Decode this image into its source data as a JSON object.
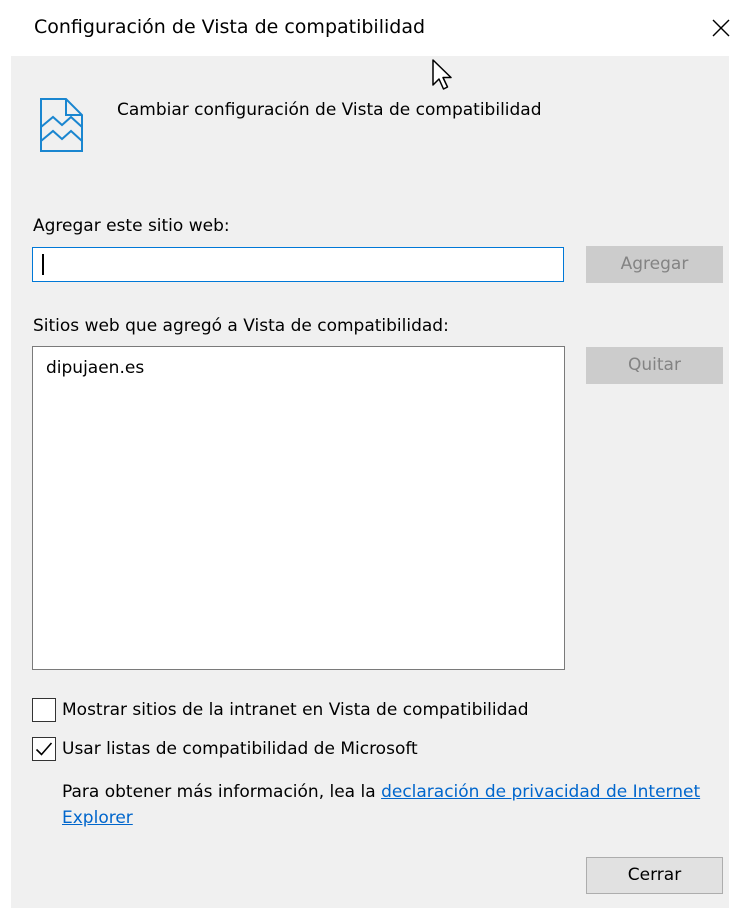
{
  "window": {
    "title": "Configuración de Vista de compatibilidad",
    "close_icon": "close-icon"
  },
  "header": {
    "icon": "compatibility-view-icon",
    "text": "Cambiar configuración de Vista de compatibilidad"
  },
  "add_site": {
    "label": "Agregar este sitio web:",
    "input_value": "",
    "button_label": "Agregar",
    "button_enabled": false
  },
  "site_list": {
    "label": "Sitios web que agregó a Vista de compatibilidad:",
    "items": [
      "dipujaen.es"
    ],
    "remove_button_label": "Quitar",
    "remove_button_enabled": false
  },
  "options": {
    "intranet": {
      "label": "Mostrar sitios de la intranet en Vista de compatibilidad",
      "checked": false
    },
    "ms_lists": {
      "label": "Usar listas de compatibilidad de Microsoft",
      "checked": true
    }
  },
  "info": {
    "prefix": "Para obtener más información, lea la ",
    "link_text": "declaración de privacidad de Internet Explorer"
  },
  "footer": {
    "close_button_label": "Cerrar"
  },
  "colors": {
    "client_bg": "#f0f0f0",
    "input_focus_border": "#0078d7",
    "disabled_button_bg": "#cccccc",
    "disabled_button_text": "#838383",
    "link": "#0066cc"
  }
}
